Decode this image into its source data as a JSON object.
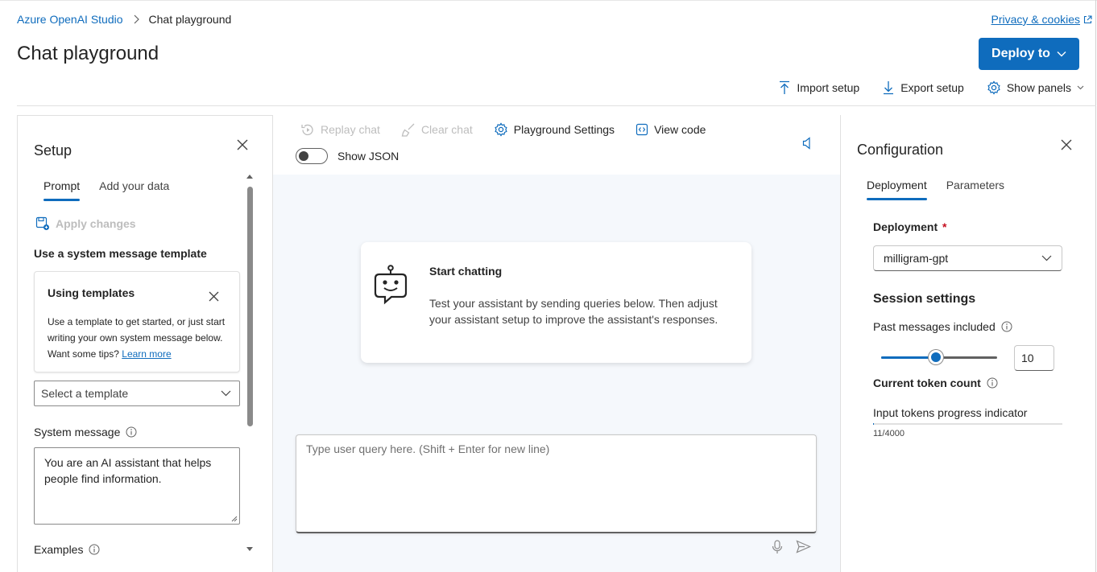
{
  "header": {
    "breadcrumb": {
      "root": "Azure OpenAI Studio",
      "current": "Chat playground"
    },
    "privacy_link": "Privacy & cookies",
    "title": "Chat playground",
    "deploy_label": "Deploy to",
    "toolbar": {
      "import": "Import setup",
      "export": "Export setup",
      "show_panels": "Show panels"
    }
  },
  "setup": {
    "title": "Setup",
    "tabs": [
      {
        "label": "Prompt",
        "active": true
      },
      {
        "label": "Add your data",
        "active": false
      }
    ],
    "apply_changes": "Apply changes",
    "template_heading": "Use a system message template",
    "templates_card": {
      "title": "Using templates",
      "body": "Use a template to get started, or just start writing your own system message below. Want some tips?",
      "link": "Learn more"
    },
    "template_select_placeholder": "Select a template",
    "system_message_label": "System message",
    "system_message_value": "You are an AI assistant that helps people find information.",
    "examples_label": "Examples"
  },
  "chat": {
    "toolbar": {
      "replay": "Replay chat",
      "clear": "Clear chat",
      "settings": "Playground Settings",
      "view_code": "View code",
      "show_json": "Show JSON"
    },
    "start_card": {
      "title": "Start chatting",
      "body": "Test your assistant by sending queries below. Then adjust your assistant setup to improve the assistant's responses."
    },
    "query_placeholder": "Type user query here. (Shift + Enter for new line)"
  },
  "config": {
    "title": "Configuration",
    "tabs": [
      {
        "label": "Deployment",
        "active": true
      },
      {
        "label": "Parameters",
        "active": false
      }
    ],
    "deployment_label": "Deployment",
    "required_marker": "*",
    "deployment_value": "milligram-gpt",
    "session_heading": "Session settings",
    "past_messages_label": "Past messages included",
    "past_messages_value": "10",
    "past_messages_fraction": 0.47,
    "token_count_label": "Current token count",
    "token_progress_label": "Input tokens progress indicator",
    "token_progress_value": "11/4000"
  },
  "colors": {
    "accent": "#0f6cbd",
    "required": "#c50f1f"
  }
}
